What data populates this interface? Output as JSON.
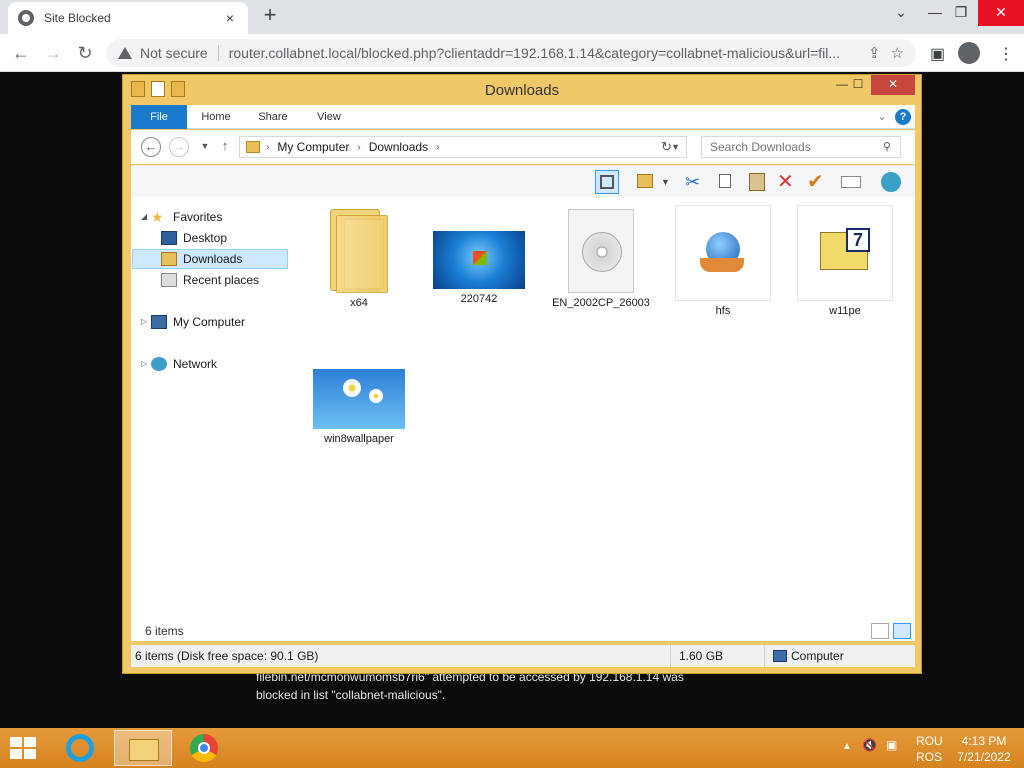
{
  "browser": {
    "tab_title": "Site Blocked",
    "tab_close": "×",
    "new_tab": "+",
    "not_secure": "Not secure",
    "url": "router.collabnet.local/blocked.php?clientaddr=192.168.1.14&category=collabnet-malicious&url=fil...",
    "back": "←",
    "forward": "→",
    "reload": "↻",
    "minimize": "⌄",
    "min2": "—",
    "restore": "❐",
    "close": "✕"
  },
  "page": {
    "blocked_line1": "filebin.net/mcmonwumomsb7ri6\" attempted to be accessed by 192.168.1.14 was",
    "blocked_line2": "blocked in list \"collabnet-malicious\"."
  },
  "explorer": {
    "title": "Downloads",
    "min": "—",
    "max": "☐",
    "close": "✕",
    "ribbon_tabs": [
      "File",
      "Home",
      "Share",
      "View"
    ],
    "help": "?",
    "breadcrumb": [
      "My Computer",
      "Downloads"
    ],
    "search_placeholder": "Search Downloads",
    "nav": {
      "favorites": "Favorites",
      "desktop": "Desktop",
      "downloads": "Downloads",
      "recent": "Recent places",
      "computer": "My Computer",
      "network": "Network"
    },
    "files": [
      "x64",
      "220742",
      "EN_2002CP_26003",
      "hfs",
      "w11pe",
      "win8wallpaper"
    ],
    "item_count": "6 items",
    "status": {
      "summary": "6 items (Disk free space: 90.1 GB)",
      "size": "1.60 GB",
      "location": "Computer"
    }
  },
  "taskbar": {
    "lang_top": "ROU",
    "lang_bottom": "ROS",
    "time": "4:13 PM",
    "date": "7/21/2022"
  }
}
